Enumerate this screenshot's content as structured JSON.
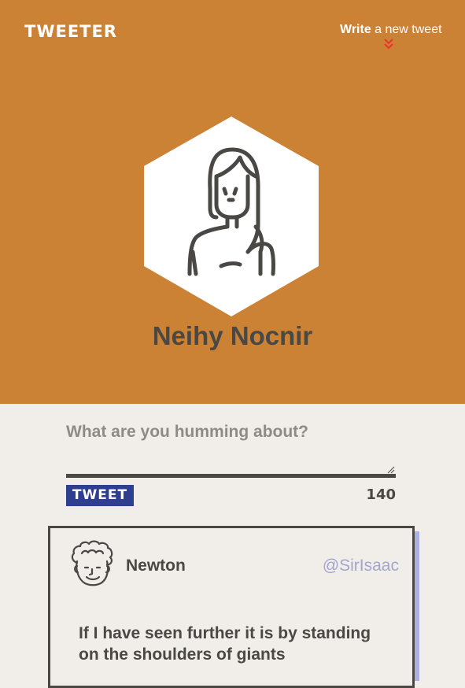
{
  "header": {
    "logo": "TWEETER",
    "write_link_strong": "Write",
    "write_link_rest": " a new tweet",
    "chevron_icon": "double-chevron-down-icon",
    "chevron_color": "#e8342a",
    "background_color": "#cb8234"
  },
  "profile": {
    "name": "Neihy Nocnir",
    "avatar_icon": "woman-avatar-icon"
  },
  "compose": {
    "prompt": "What are you humming about?",
    "input_value": "",
    "button_label": "TWEET",
    "button_color": "#2f3f8f",
    "char_count": "140"
  },
  "tweets": [
    {
      "author": "Newton",
      "handle": "@SirIsaac",
      "text": "If I have seen further it is by standing on the shoulders of giants",
      "avatar_icon": "man-curly-hair-avatar-icon"
    }
  ]
}
